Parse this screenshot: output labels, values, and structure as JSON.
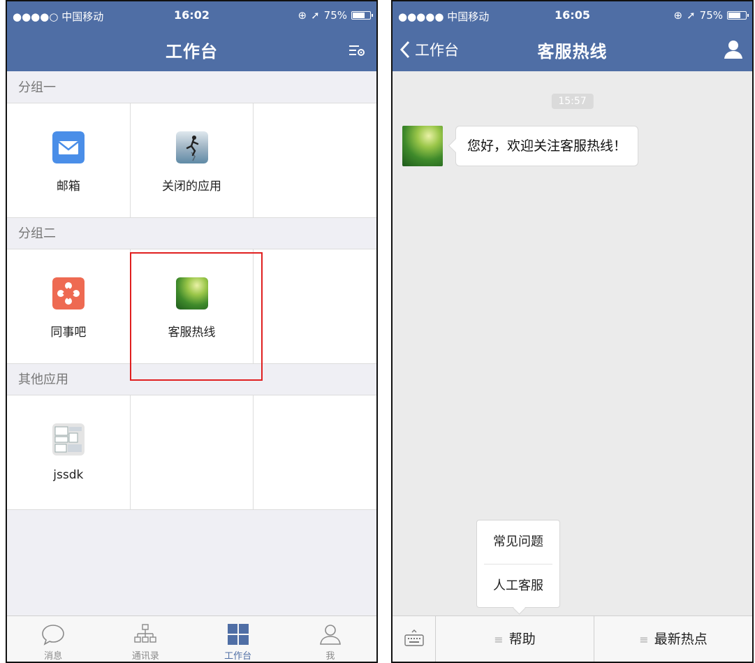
{
  "left": {
    "status": {
      "carrier": "●●●●○ 中国移动",
      "time": "16:02",
      "battery": "75%",
      "battery_level": 0.75
    },
    "nav": {
      "title": "工作台",
      "settings_icon": "list-settings-icon"
    },
    "groups": [
      {
        "title": "分组一",
        "apps": [
          {
            "label": "邮箱",
            "icon": "mail-icon"
          },
          {
            "label": "关闭的应用",
            "icon": "runner-icon"
          },
          {
            "label": "",
            "icon": ""
          }
        ]
      },
      {
        "title": "分组二",
        "apps": [
          {
            "label": "同事吧",
            "icon": "share-network-icon"
          },
          {
            "label": "客服热线",
            "icon": "green-leaf-icon"
          },
          {
            "label": "",
            "icon": ""
          }
        ]
      },
      {
        "title": "其他应用",
        "apps": [
          {
            "label": "jssdk",
            "icon": "jssdk-icon"
          },
          {
            "label": "",
            "icon": ""
          },
          {
            "label": "",
            "icon": ""
          }
        ]
      }
    ],
    "tabs": [
      {
        "label": "消息",
        "icon": "chat-bubble-icon"
      },
      {
        "label": "通讯录",
        "icon": "org-chart-icon"
      },
      {
        "label": "工作台",
        "icon": "grid-icon",
        "active": true
      },
      {
        "label": "我",
        "icon": "person-icon"
      }
    ]
  },
  "right": {
    "status": {
      "carrier": "●●●●● 中国移动",
      "time": "16:05",
      "battery": "75%",
      "battery_level": 0.75
    },
    "nav": {
      "back_label": "工作台",
      "title": "客服热线"
    },
    "chat": {
      "timestamp": "15:57",
      "message": "您好，欢迎关注客服热线！"
    },
    "popup": {
      "items": [
        "常见问题",
        "人工客服"
      ]
    },
    "menu": {
      "items": [
        "帮助",
        "最新热点"
      ]
    }
  },
  "colors": {
    "nav_bg": "#4f6ea5",
    "highlight": "#e02020",
    "active_tab": "#4f6ea5"
  }
}
